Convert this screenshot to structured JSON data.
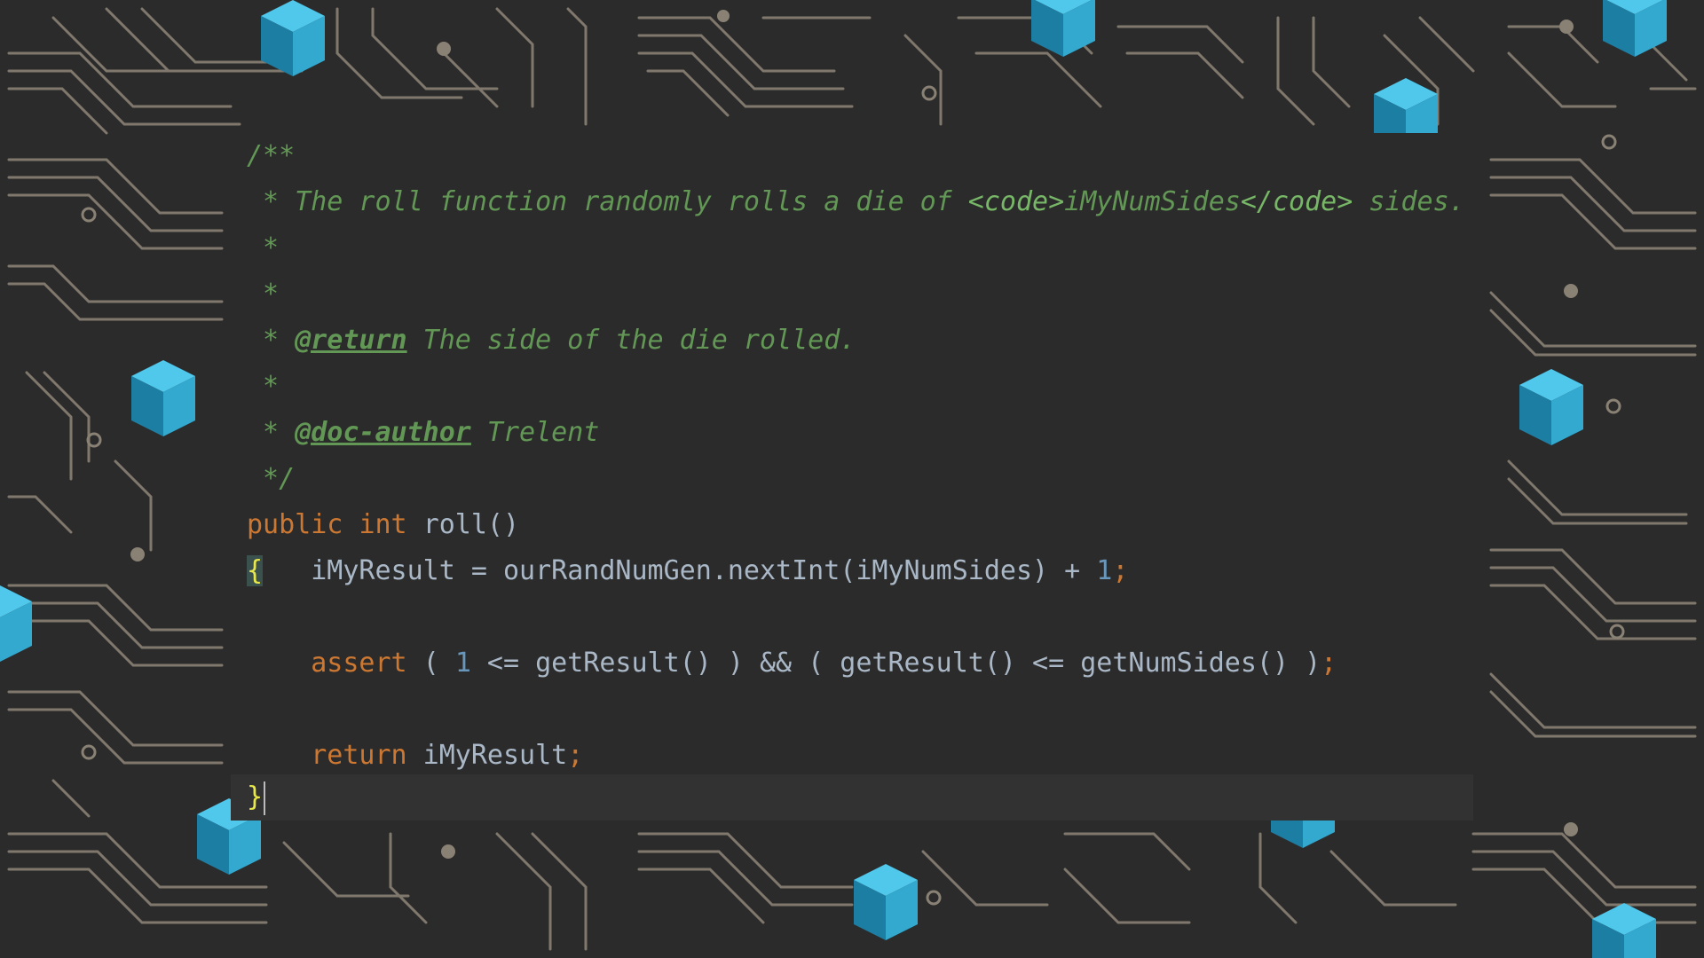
{
  "colors": {
    "background": "#2b2b2b",
    "circuit_trace": "#8a8175",
    "comment": "#629755",
    "keyword": "#cc7832",
    "number": "#6897bb",
    "text": "#a9b7c6",
    "brace_match": "#e8e84b",
    "cube_light": "#4fc8ec",
    "cube_mid": "#33a9d0",
    "cube_dark": "#1c7ea3"
  },
  "code": {
    "doc_open": "/**",
    "doc_line1_prefix": " * The roll function randomly rolls a die of ",
    "doc_line1_tag": "<code>",
    "doc_line1_var": "iMyNumSides",
    "doc_line1_tag_close": "</code>",
    "doc_line1_suffix": " sides.",
    "doc_blank1": " *",
    "doc_blank2": " *",
    "doc_return_prefix": " * ",
    "doc_return_tag": "@return",
    "doc_return_text": " The side of the die rolled.",
    "doc_blank3": " *",
    "doc_author_prefix": " * ",
    "doc_author_tag": "@doc-author",
    "doc_author_text": " Trelent",
    "doc_close": " */",
    "sig_public": "public",
    "sig_int": "int",
    "sig_name": "roll()",
    "open_brace": "{",
    "assign_text": "   iMyResult = ourRandNumGen.nextInt(iMyNumSides) + ",
    "assign_num": "1",
    "assign_semi": ";",
    "assert_kw": "assert",
    "assert_a": " ( ",
    "assert_num": "1",
    "assert_b": " <= getResult() ) && ( getResult() <= getNumSides() )",
    "assert_semi": ";",
    "return_kw": "return",
    "return_val": " iMyResult",
    "return_semi": ";",
    "close_brace": "}"
  }
}
